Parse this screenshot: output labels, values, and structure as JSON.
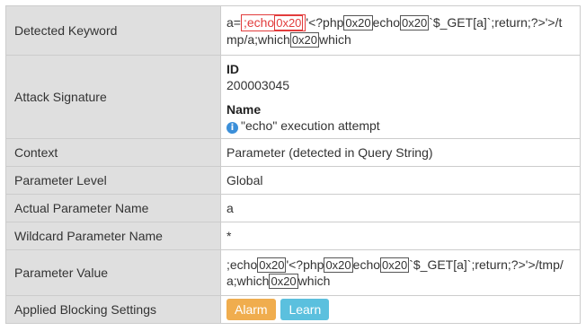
{
  "rows": {
    "detected_keyword": {
      "label": "Detected Keyword",
      "prefix": "a=",
      "highlight": {
        "text1": ";echo",
        "hex": "0x20"
      },
      "parts": [
        "'<?php",
        "0x20",
        "echo",
        "0x20",
        "`$_GET[a]`;return;?>'>/t",
        "mp/a;which",
        "0x20",
        "which"
      ]
    },
    "attack_signature": {
      "label": "Attack Signature",
      "id_label": "ID",
      "id_value": "200003045",
      "name_label": "Name",
      "name_value": "\"echo\" execution attempt",
      "name_icon": "info-icon"
    },
    "context": {
      "label": "Context",
      "value": "Parameter (detected in Query String)"
    },
    "parameter_level": {
      "label": "Parameter Level",
      "value": "Global"
    },
    "actual_parameter_name": {
      "label": "Actual Parameter Name",
      "value": "a"
    },
    "wildcard_parameter_name": {
      "label": "Wildcard Parameter Name",
      "value": "*"
    },
    "parameter_value": {
      "label": "Parameter Value",
      "parts": [
        ";echo",
        "0x20",
        "'<?php",
        "0x20",
        "echo",
        "0x20",
        "`$_GET[a]`;return;?>'>/tmp/",
        "a;which",
        "0x20",
        "which"
      ]
    },
    "applied_blocking_settings": {
      "label": "Applied Blocking Settings",
      "buttons": [
        "Alarm",
        "Learn"
      ]
    }
  },
  "colors": {
    "label_bg": "#dfdfdf",
    "border": "#cccccc",
    "highlight": "#e23c3c",
    "alarm": "#f0ad4e",
    "learn": "#5bc0de",
    "info_icon": "#3b8fd9"
  }
}
